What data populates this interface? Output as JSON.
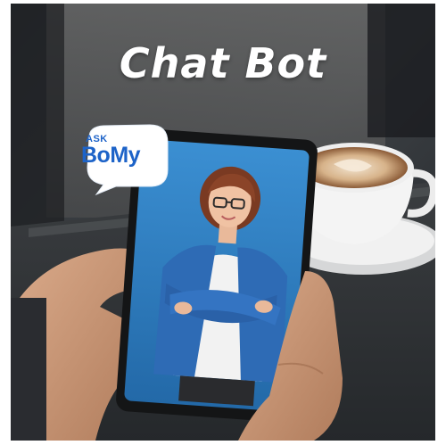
{
  "headline": "Chat Bot",
  "bubble": {
    "ask": "ASK",
    "name": "BoMy"
  },
  "colors": {
    "accent": "#1d63c8",
    "screen": "#2f82c8",
    "coffee_foam": "#d9b893",
    "jacket": "#2e6bb5"
  },
  "icons": [
    "speech-bubble-icon",
    "avatar-illustration",
    "coffee-cup"
  ]
}
